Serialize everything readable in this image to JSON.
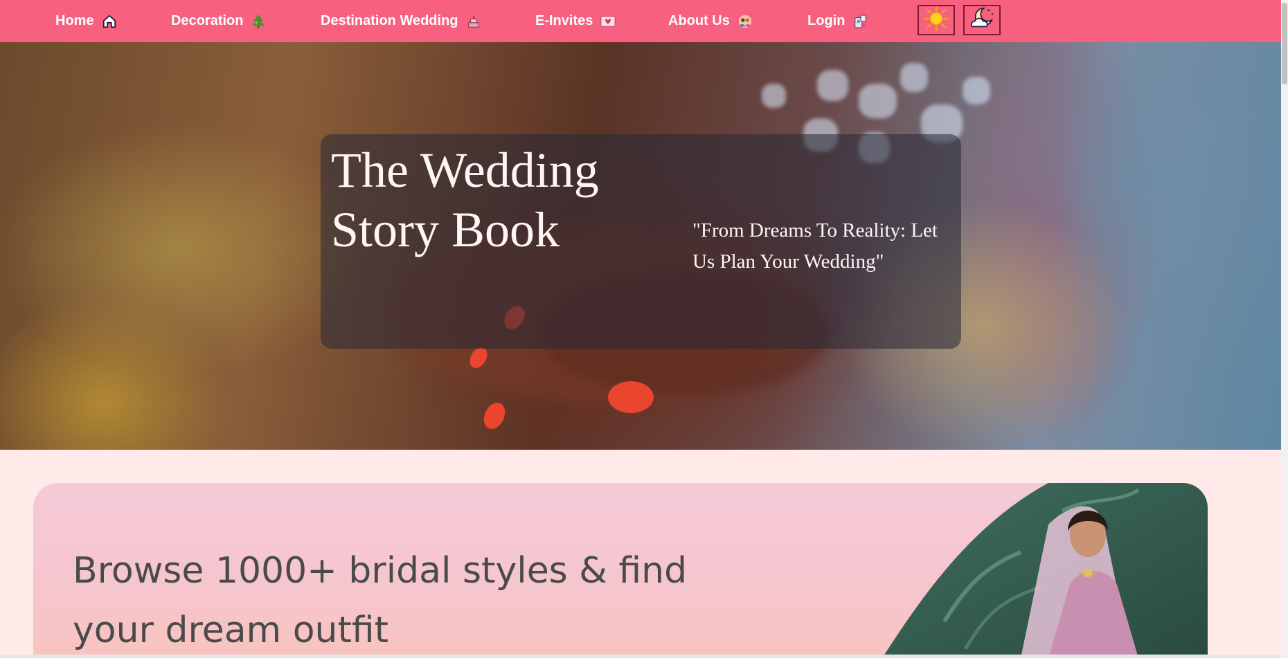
{
  "nav": {
    "items": [
      {
        "label": "Home",
        "icon": "home-icon"
      },
      {
        "label": "Decoration",
        "icon": "christmas-tree-icon"
      },
      {
        "label": "Destination Wedding",
        "icon": "wedding-cake-icon"
      },
      {
        "label": "E-Invites",
        "icon": "love-letter-icon"
      },
      {
        "label": "About Us",
        "icon": "couple-icon"
      },
      {
        "label": "Login",
        "icon": "login-icon"
      }
    ],
    "light_mode_icon": "sun-icon",
    "dark_mode_icon": "moon-cloud-icon"
  },
  "hero": {
    "title_line1": "The Wedding",
    "title_line2": "Story Book",
    "quote": "\"From Dreams To Reality: Let Us Plan Your Wedding\""
  },
  "banner": {
    "line1": "Browse 1000+ bridal styles & find",
    "line2": "your dream outfit"
  },
  "colors": {
    "nav_bg": "#f7617f",
    "page_bg": "#ffe9e9",
    "banner_text": "#4a4a4a"
  }
}
